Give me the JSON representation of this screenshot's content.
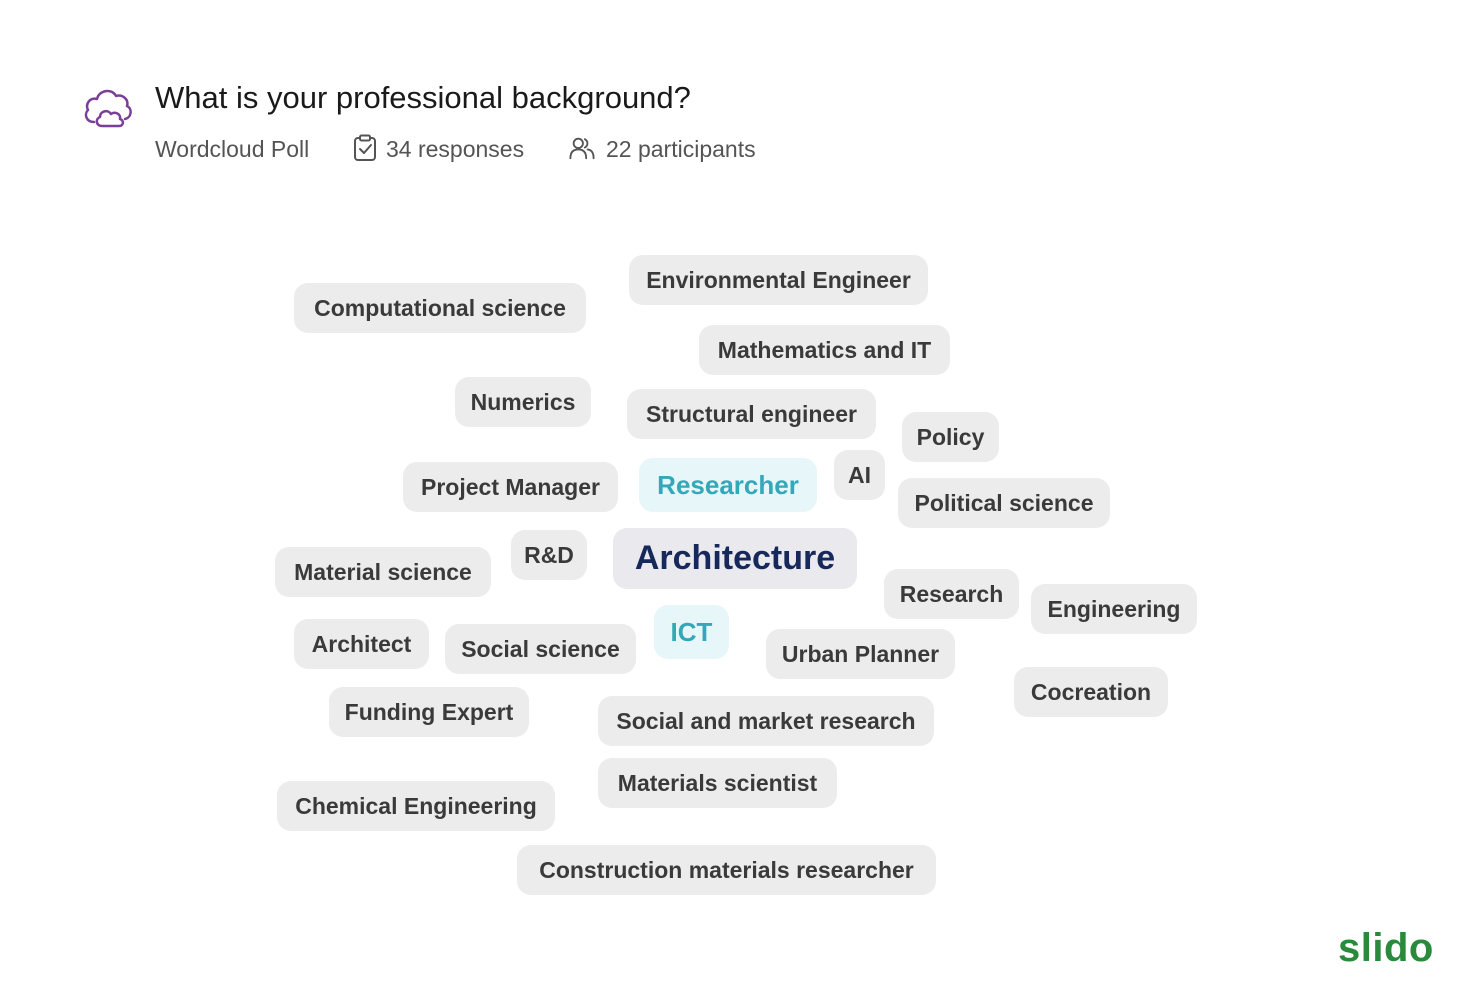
{
  "question": {
    "title": "What is your professional background?",
    "poll_type": "Wordcloud Poll",
    "responses": "34 responses",
    "participants": "22 participants",
    "icon": "wordcloud-icon"
  },
  "wordcloud": {
    "words": [
      "Environmental Engineer",
      "Computational science",
      "Mathematics and IT",
      "Numerics",
      "Structural engineer",
      "Policy",
      "Project Manager",
      "Researcher",
      "AI",
      "Political science",
      "R&D",
      "Architecture",
      "Material science",
      "Research",
      "Engineering",
      "Architect",
      "Social science",
      "ICT",
      "Urban Planner",
      "Cocreation",
      "Funding Expert",
      "Social and market research",
      "Materials scientist",
      "Chemical Engineering",
      "Construction materials researcher"
    ]
  },
  "colors": {
    "chip_bg": "#ececec",
    "chip_text": "#3a3a3a",
    "highlight_bg": "#e6f6f9",
    "highlight_text": "#34a8b8",
    "top_word_text": "#17285a",
    "brand": "#2a8a3c",
    "icon": "#7b3f98"
  },
  "brand": {
    "name": "slido"
  }
}
